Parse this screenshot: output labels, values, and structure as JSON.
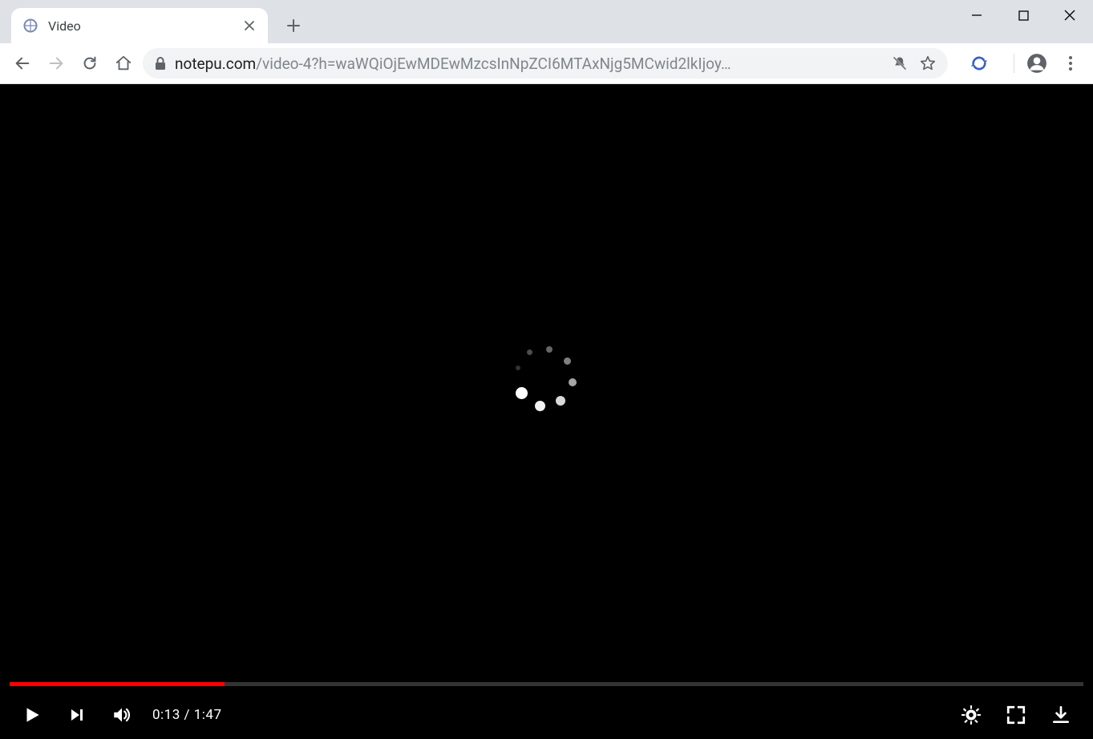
{
  "browser": {
    "tab_title": "Video",
    "url_domain": "notepu.com",
    "url_path": "/video-4?h=waWQiOjEwMDEwMzcsInNpZCI6MTAxNjg5MCwid2lkIjoy…"
  },
  "player": {
    "current_time": "0:13",
    "separator": " / ",
    "duration": "1:47",
    "progress_percent": 20
  }
}
